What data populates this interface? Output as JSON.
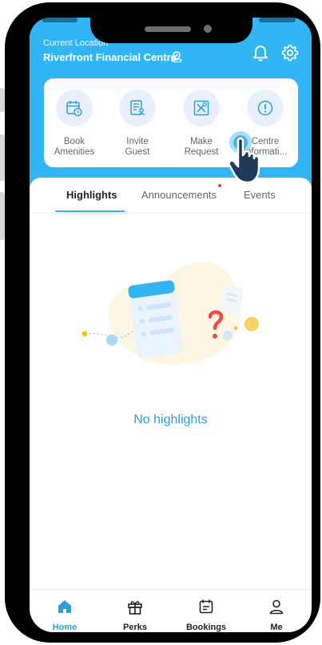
{
  "header": {
    "location_label": "Current Location",
    "location_name": "Riverfront Financial Centre"
  },
  "quick_actions": [
    {
      "line1": "Book",
      "line2": "Amenities",
      "icon": "calendar-clock-icon"
    },
    {
      "line1": "Invite",
      "line2": "Guest",
      "icon": "guest-card-icon"
    },
    {
      "line1": "Make",
      "line2": "Request",
      "icon": "tools-icon"
    },
    {
      "line1": "Centre",
      "line2": "Informati...",
      "icon": "info-icon"
    }
  ],
  "tabs": [
    {
      "label": "Highlights",
      "active": true
    },
    {
      "label": "Announcements",
      "badge": true
    },
    {
      "label": "Events"
    }
  ],
  "empty_state": {
    "message": "No highlights"
  },
  "bottom_nav": [
    {
      "label": "Home",
      "icon": "home-icon",
      "active": true
    },
    {
      "label": "Perks",
      "icon": "gift-icon"
    },
    {
      "label": "Bookings",
      "icon": "bookings-icon"
    },
    {
      "label": "Me",
      "icon": "person-icon"
    }
  ],
  "colors": {
    "accent": "#32b5f5",
    "link": "#2d9ed8",
    "badge": "#e53935"
  }
}
